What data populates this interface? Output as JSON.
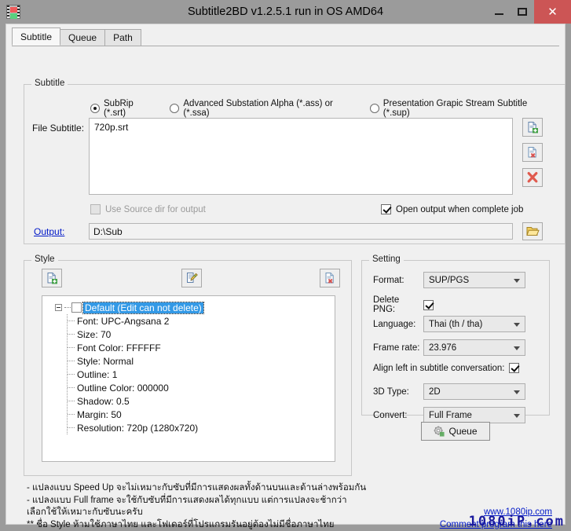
{
  "window": {
    "title": "Subtitle2BD v1.2.5.1 run in OS AMD64",
    "app_icon": "film-strip-icon",
    "minimize_label": "—",
    "maximize_label": "□",
    "close_label": "✕",
    "close_color": "#cc5555"
  },
  "tabs": [
    {
      "label": "Subtitle",
      "active": true
    },
    {
      "label": "Queue",
      "active": false
    },
    {
      "label": "Path",
      "active": false
    }
  ],
  "subtitle_group": {
    "legend": "Subtitle",
    "formats": [
      {
        "label": "SubRip (*.srt)",
        "checked": true
      },
      {
        "label": "Advanced Substation Alpha (*.ass) or (*.ssa)",
        "checked": false
      },
      {
        "label": "Presentation Grapic Stream Subtitle (*.sup)",
        "checked": false
      }
    ],
    "file_label": "File Subtitle:",
    "file_list": "720p.srt",
    "buttons": {
      "add": "add-file-icon",
      "remove": "remove-file-icon",
      "clear": "clear-all-icon"
    },
    "use_source_dir": {
      "label": "Use Source dir for output",
      "checked": false,
      "disabled": true
    },
    "open_output": {
      "label": "Open output when complete job",
      "checked": true
    },
    "output_link": "Output:",
    "output_value": "D:\\Sub",
    "browse_icon": "folder-open-icon"
  },
  "style_group": {
    "legend": "Style",
    "toolbar": {
      "add": "add-style-icon",
      "edit": "edit-style-icon",
      "delete": "delete-style-icon"
    },
    "tree": {
      "root": "Default (Edit can not delete)",
      "children": [
        "Font: UPC-Angsana 2",
        "Size: 70",
        "Font Color: FFFFFF",
        "Style: Normal",
        "Outline: 1",
        "Outline Color: 000000",
        "Shadow: 0.5",
        "Margin: 50",
        "Resolution: 720p (1280x720)"
      ],
      "selection_color": "#3399e6"
    }
  },
  "setting_group": {
    "legend": "Setting",
    "format": {
      "label": "Format:",
      "value": "SUP/PGS"
    },
    "delete_png": {
      "label": "Delete PNG:",
      "checked": true
    },
    "language": {
      "label": "Language:",
      "value": "Thai (th / tha)"
    },
    "frame_rate": {
      "label": "Frame rate:",
      "value": "23.976"
    },
    "align_left": {
      "label": "Align left in subtitle conversation:",
      "checked": true
    },
    "three_d_type": {
      "label": "3D Type:",
      "value": "2D"
    },
    "convert": {
      "label": "Convert:",
      "value": "Full Frame"
    }
  },
  "queue_button": {
    "label": "Queue",
    "icon": "gear-icon"
  },
  "notes": {
    "line1": "- แปลงแบบ Speed Up จะไม่เหมาะกับซับที่มีการแสดงผลทั้งด้านบนและด้านล่างพร้อมกัน",
    "line2": "- แปลงแบบ Full frame จะใช้กับซับที่มีการแสดงผลได้ทุกแบบ แต่การแปลงจะช้ากว่า",
    "line3": "เลือกใช้ให้เหมาะกับซับนะครับ",
    "line4": "** ชื่อ Style ห้ามใช้ภาษาไทย และโฟเดอร์ที่โปรแกรมรันอยู่ต้องไม่มีชื่อภาษาไทย"
  },
  "links": {
    "website": "www.1080ip.com",
    "comment": "Comment program this here",
    "link_color": "#0018c8"
  },
  "brand": "1080iP.com"
}
